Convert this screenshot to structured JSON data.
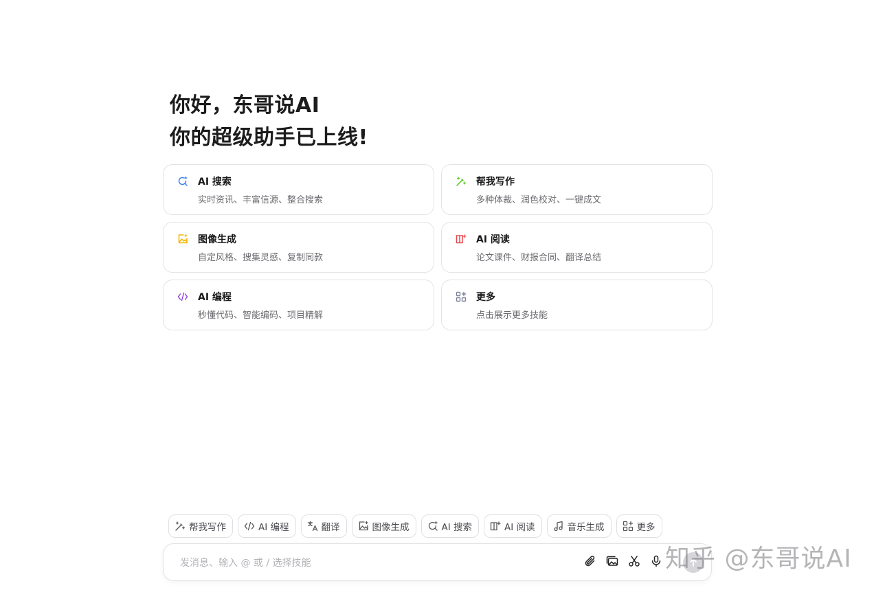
{
  "greeting": {
    "line1": "你好，东哥说AI",
    "line2": "你的超级助手已上线!"
  },
  "cards": [
    {
      "title": "AI 搜索",
      "desc": "实时资讯、丰富信源、整合搜索",
      "icon": "search-sparkle-icon",
      "color": "#3b82f6"
    },
    {
      "title": "帮我写作",
      "desc": "多种体裁、润色校对、一键成文",
      "icon": "magic-pen-icon",
      "color": "#52c41a"
    },
    {
      "title": "图像生成",
      "desc": "自定风格、搜集灵感、复制同款",
      "icon": "image-sparkle-icon",
      "color": "#f5b400"
    },
    {
      "title": "AI 阅读",
      "desc": "论文课件、财报合同、翻译总结",
      "icon": "book-sparkle-icon",
      "color": "#e5484d"
    },
    {
      "title": "AI 编程",
      "desc": "秒懂代码、智能编码、项目精解",
      "icon": "code-icon",
      "color": "#8b3fd9"
    },
    {
      "title": "更多",
      "desc": "点击展示更多技能",
      "icon": "apps-icon",
      "color": "#7d8199"
    }
  ],
  "chips": [
    {
      "label": "帮我写作",
      "icon": "magic-pen-icon"
    },
    {
      "label": "AI 编程",
      "icon": "code-icon"
    },
    {
      "label": "翻译",
      "icon": "translate-icon"
    },
    {
      "label": "图像生成",
      "icon": "image-icon"
    },
    {
      "label": "AI 搜索",
      "icon": "search-icon"
    },
    {
      "label": "AI 阅读",
      "icon": "book-icon"
    },
    {
      "label": "音乐生成",
      "icon": "music-icon"
    },
    {
      "label": "更多",
      "icon": "apps-icon"
    }
  ],
  "input": {
    "placeholder": "发消息、输入 @ 或 / 选择技能"
  },
  "watermark": "知乎 @东哥说AI"
}
